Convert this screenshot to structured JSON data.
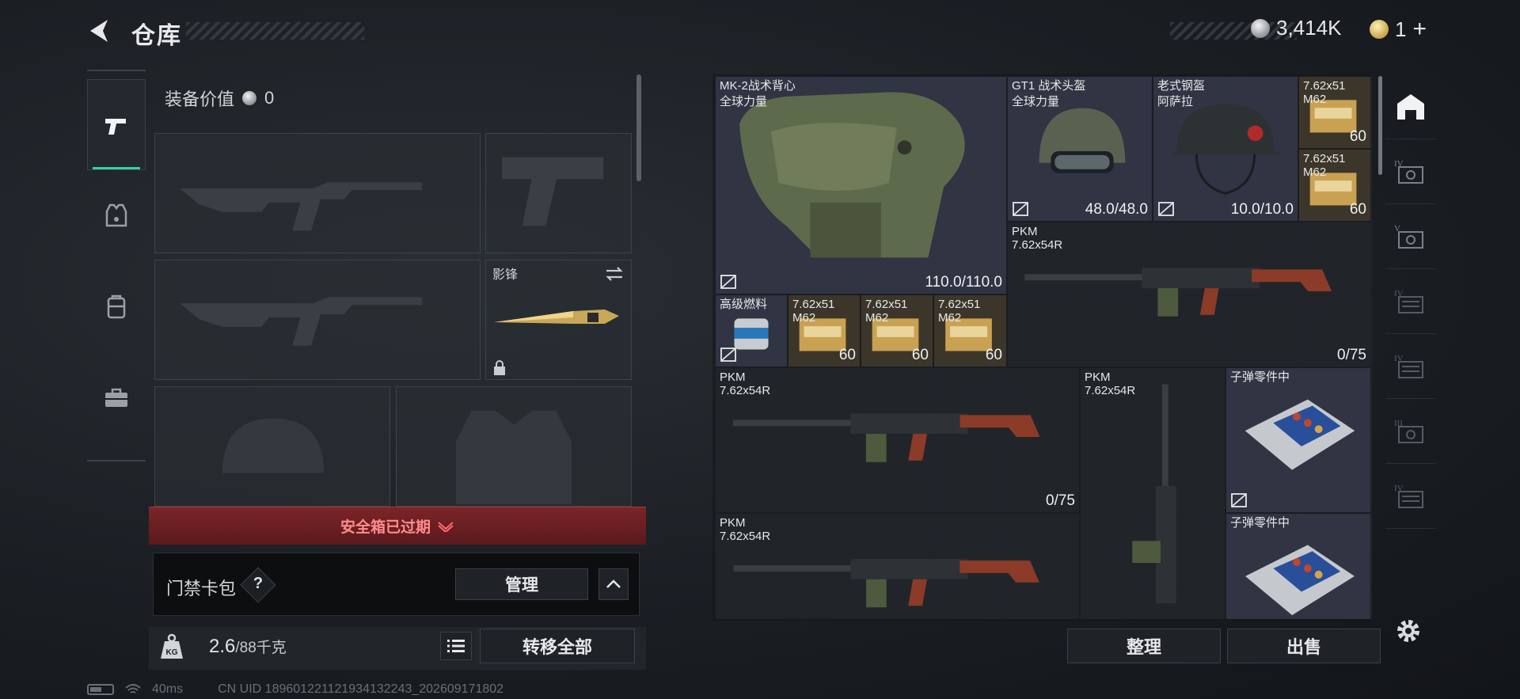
{
  "header": {
    "title": "仓库",
    "currency_amount": "3,414K",
    "premium_amount": "1",
    "plus_label": "+"
  },
  "left_tabs": [
    {
      "name": "weapons",
      "icon": "pistol-icon",
      "active": true
    },
    {
      "name": "armor",
      "icon": "vest-icon",
      "active": false
    },
    {
      "name": "backpack",
      "icon": "backpack-icon",
      "active": false
    },
    {
      "name": "toolbox",
      "icon": "toolbox-icon",
      "active": false
    }
  ],
  "loadout": {
    "equip_value_label": "装备价值",
    "equip_value": "0",
    "melee_slot_label": "影锋",
    "safebox_status": "安全箱已过期",
    "keycard_label": "门禁卡包",
    "keycard_help": "?",
    "manage_label": "管理",
    "weight_current": "2.6",
    "weight_capacity": "/88千克",
    "transfer_all_label": "转移全部"
  },
  "storage": {
    "items": [
      {
        "id": "vest",
        "name": "MK-2战术背心",
        "sub": "全球力量",
        "count": "110.0/110.0"
      },
      {
        "id": "helmet1",
        "name": "GT1 战术头盔",
        "sub": "全球力量",
        "count": "48.0/48.0"
      },
      {
        "id": "helmet2",
        "name": "老式钢盔",
        "sub": "阿萨拉",
        "count": "10.0/10.0"
      },
      {
        "id": "ammo1",
        "name": "7.62x51",
        "sub": "M62",
        "count": "60"
      },
      {
        "id": "ammo2",
        "name": "7.62x51",
        "sub": "M62",
        "count": "60"
      },
      {
        "id": "pkm1",
        "name": "PKM",
        "sub": "7.62x54R",
        "count": "0/75"
      },
      {
        "id": "fuel",
        "name": "高级燃料",
        "sub": "",
        "count": ""
      },
      {
        "id": "ammo3",
        "name": "7.62x51",
        "sub": "M62",
        "count": "60"
      },
      {
        "id": "ammo4",
        "name": "7.62x51",
        "sub": "M62",
        "count": "60"
      },
      {
        "id": "ammo5",
        "name": "7.62x51",
        "sub": "M62",
        "count": "60"
      },
      {
        "id": "pkm2",
        "name": "PKM",
        "sub": "7.62x54R",
        "count": "0/75"
      },
      {
        "id": "pkm3",
        "name": "PKM",
        "sub": "7.62x54R",
        "count": ""
      },
      {
        "id": "parts1",
        "name": "子弹零件中",
        "sub": "",
        "count": ""
      },
      {
        "id": "pkm4",
        "name": "PKM",
        "sub": "7.62x54R",
        "count": ""
      },
      {
        "id": "parts2",
        "name": "子弹零件中",
        "sub": "",
        "count": ""
      }
    ],
    "sort_label": "整理",
    "sell_label": "出售"
  },
  "right_tabs": [
    {
      "icon": "storage-home-icon",
      "active": true
    },
    {
      "icon": "tier-iv-case-icon",
      "label": "IV"
    },
    {
      "icon": "tier-v-case-icon",
      "label": "V"
    },
    {
      "icon": "tier-iv-box-icon",
      "label": "IV"
    },
    {
      "icon": "tier-iv-box-icon",
      "label": "IV"
    },
    {
      "icon": "tier-iii-case-icon",
      "label": "III"
    },
    {
      "icon": "tier-iv-box-icon",
      "label": "IV"
    }
  ],
  "status": {
    "ping": "40ms",
    "uid": "CN UID 1896012211219341322​43_202609171802"
  },
  "colors": {
    "accent": "#2fd5a2",
    "danger": "#7b2428",
    "danger_text": "#ff8d8d"
  }
}
